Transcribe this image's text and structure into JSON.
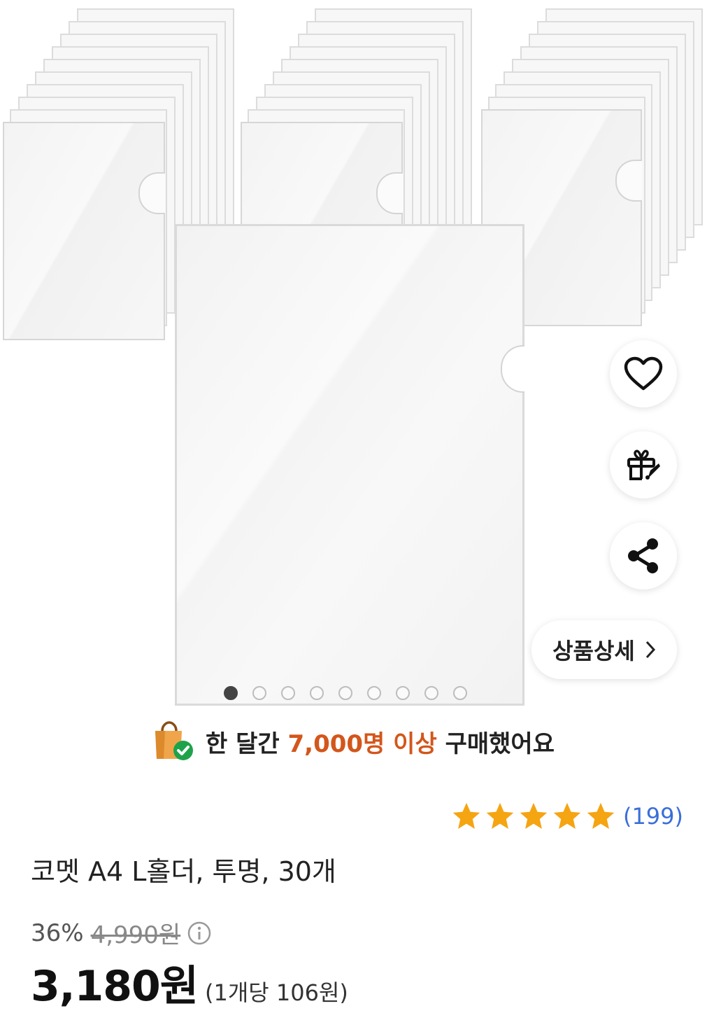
{
  "gallery": {
    "image_alt": "A4 L홀더 투명 30개",
    "dots_total": 9,
    "dots_active_index": 0
  },
  "actions": {
    "wishlist_icon": "heart-outline-icon",
    "gift_icon": "gift-icon",
    "share_icon": "share-icon",
    "detail_label": "상품상세"
  },
  "purchase_banner": {
    "prefix": "한 달간",
    "highlight": "7,000명 이상",
    "suffix": "구매했어요",
    "highlight_color": "#d3561b"
  },
  "rating": {
    "stars": 5,
    "review_count": "(199)",
    "star_color": "#f5a412",
    "count_color": "#3a6fd8"
  },
  "product": {
    "title": "코멧 A4 L홀더, 투명, 30개",
    "discount": "36%",
    "original_price": "4,990원",
    "price": "3,180원",
    "unit_price": "(1개당 106원)"
  }
}
